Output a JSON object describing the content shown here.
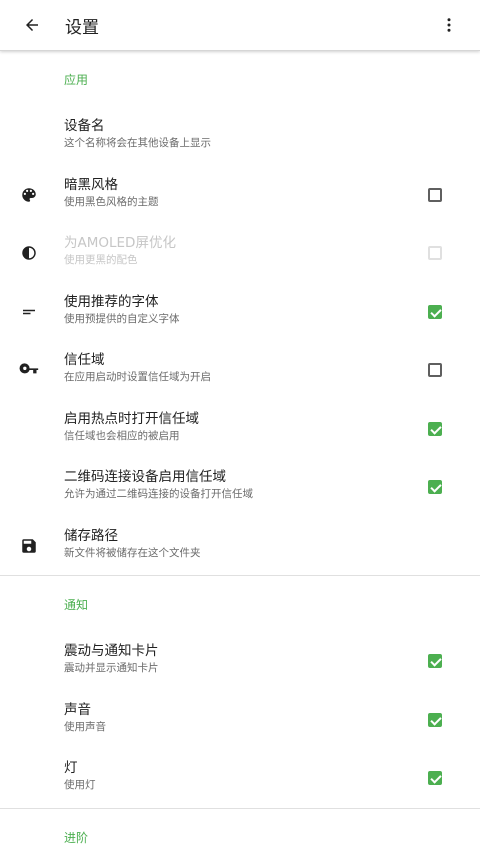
{
  "appbar": {
    "title": "设置",
    "back_icon": "arrow-back-icon",
    "more_icon": "more-vert-icon"
  },
  "sections": {
    "app": {
      "header": "应用",
      "items": [
        {
          "title": "设备名",
          "subtitle": "这个名称将会在其他设备上显示"
        },
        {
          "title": "暗黑风格",
          "subtitle": "使用黑色风格的主题",
          "icon": "palette-icon",
          "checked": false
        },
        {
          "title": "为AMOLED屏优化",
          "subtitle": "使用更黑的配色",
          "icon": "contrast-icon",
          "checked": false,
          "disabled": true
        },
        {
          "title": "使用推荐的字体",
          "subtitle": "使用预提供的自定义字体",
          "icon": "short-text-icon",
          "checked": true
        },
        {
          "title": "信任域",
          "subtitle": "在应用启动时设置信任域为开启",
          "icon": "key-icon",
          "checked": false
        },
        {
          "title": "启用热点时打开信任域",
          "subtitle": "信任域也会相应的被启用",
          "checked": true
        },
        {
          "title": "二维码连接设备启用信任域",
          "subtitle": "允许为通过二维码连接的设备打开信任域",
          "checked": true
        },
        {
          "title": "储存路径",
          "subtitle": "新文件将被储存在这个文件夹",
          "icon": "save-icon"
        }
      ]
    },
    "notify": {
      "header": "通知",
      "items": [
        {
          "title": "震动与通知卡片",
          "subtitle": "震动并显示通知卡片",
          "checked": true
        },
        {
          "title": "声音",
          "subtitle": "使用声音",
          "checked": true
        },
        {
          "title": "灯",
          "subtitle": "使用灯",
          "checked": true
        }
      ]
    },
    "advanced": {
      "header": "进阶"
    }
  },
  "colors": {
    "accent": "#4caf50",
    "text_primary": "#212121",
    "text_secondary": "#6b6b6b"
  }
}
